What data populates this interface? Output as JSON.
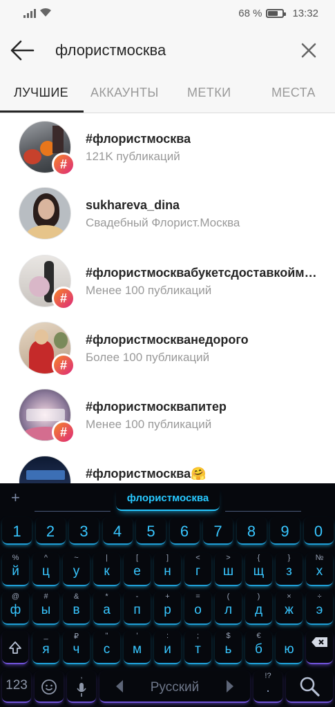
{
  "status": {
    "battery": "68 %",
    "battery_level": 0.68,
    "time": "13:32"
  },
  "search": {
    "query": "флористмосква"
  },
  "tabs": [
    "ЛУЧШИЕ",
    "АККАУНТЫ",
    "МЕТКИ",
    "МЕСТА"
  ],
  "results": [
    {
      "title": "#флористмосква",
      "subtitle": "121K публикаций",
      "hashtag": true
    },
    {
      "title": "sukhareva_dina",
      "subtitle": "Свадебный Флорист.Москва",
      "hashtag": false
    },
    {
      "title": "#флористмосквабукетсдоставкойм…",
      "subtitle": "Менее 100 публикаций",
      "hashtag": true
    },
    {
      "title": "#флористмоскванедорого",
      "subtitle": "Более 100 публикаций",
      "hashtag": true
    },
    {
      "title": "#флористмосквапитер",
      "subtitle": "Менее 100 публикаций",
      "hashtag": true
    },
    {
      "title": "#флористмосква🤗",
      "subtitle": "",
      "hashtag": true
    }
  ],
  "badge_symbol": "#",
  "keyboard": {
    "plus": "+",
    "suggestion": "флористмосква",
    "numbers": [
      "1",
      "2",
      "3",
      "4",
      "5",
      "6",
      "7",
      "8",
      "9",
      "0"
    ],
    "row1": {
      "main": [
        "й",
        "ц",
        "у",
        "к",
        "е",
        "н",
        "г",
        "ш",
        "щ",
        "з",
        "х"
      ],
      "sub": [
        "%",
        "^",
        "~",
        "|",
        "[",
        "]",
        "<",
        ">",
        "{",
        "}",
        "№"
      ]
    },
    "row2": {
      "main": [
        "ф",
        "ы",
        "в",
        "а",
        "п",
        "р",
        "о",
        "л",
        "д",
        "ж",
        "э"
      ],
      "sub": [
        "@",
        "#",
        "&",
        "*",
        "-",
        "+",
        "=",
        "(",
        ")",
        "×",
        "÷"
      ]
    },
    "row3": {
      "main": [
        "я",
        "ч",
        "с",
        "м",
        "и",
        "т",
        "ь",
        "б",
        "ю"
      ],
      "sub": [
        "_",
        "₽",
        "\"",
        "'",
        ":",
        ";",
        "$",
        "€",
        ""
      ]
    },
    "mode_label": "123",
    "space_label": "Русский",
    "mic_sub": ",",
    "period": ".",
    "period_sub": "!?"
  }
}
